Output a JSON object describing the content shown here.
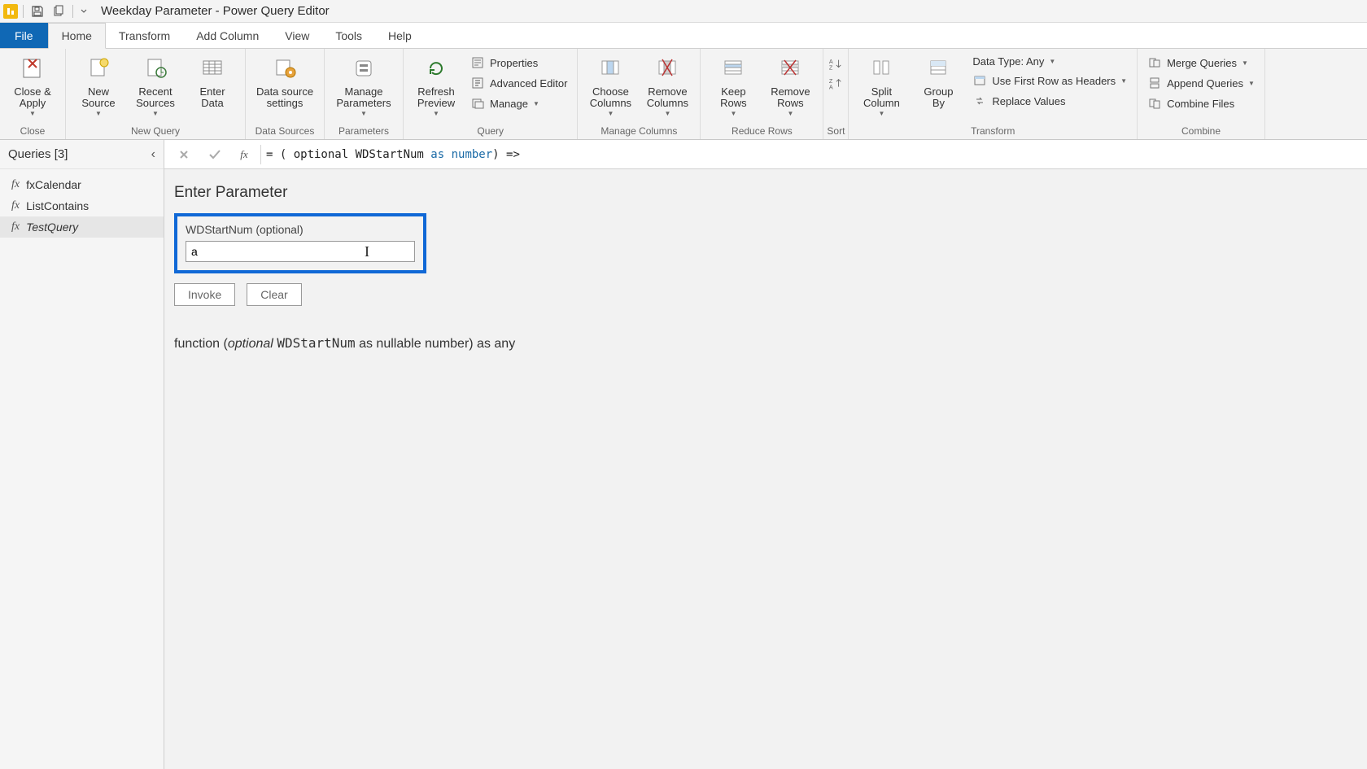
{
  "window_title": "Weekday Parameter - Power Query Editor",
  "tabs": {
    "file": "File",
    "home": "Home",
    "transform": "Transform",
    "add_column": "Add Column",
    "view": "View",
    "tools": "Tools",
    "help": "Help"
  },
  "ribbon": {
    "close_group": {
      "label": "Close",
      "close_apply": "Close &\nApply"
    },
    "new_query_group": {
      "label": "New Query",
      "new_source": "New\nSource",
      "recent_sources": "Recent\nSources",
      "enter_data": "Enter\nData"
    },
    "data_sources_group": {
      "label": "Data Sources",
      "data_source_settings": "Data source\nsettings"
    },
    "parameters_group": {
      "label": "Parameters",
      "manage_parameters": "Manage\nParameters"
    },
    "query_group": {
      "label": "Query",
      "refresh_preview": "Refresh\nPreview",
      "properties": "Properties",
      "advanced_editor": "Advanced Editor",
      "manage": "Manage"
    },
    "manage_columns_group": {
      "label": "Manage Columns",
      "choose_columns": "Choose\nColumns",
      "remove_columns": "Remove\nColumns"
    },
    "reduce_rows_group": {
      "label": "Reduce Rows",
      "keep_rows": "Keep\nRows",
      "remove_rows": "Remove\nRows"
    },
    "sort_group": {
      "label": "Sort"
    },
    "transform_group": {
      "label": "Transform",
      "split_column": "Split\nColumn",
      "group_by": "Group\nBy",
      "data_type": "Data Type: Any",
      "first_row_headers": "Use First Row as Headers",
      "replace_values": "Replace Values"
    },
    "combine_group": {
      "label": "Combine",
      "merge_queries": "Merge Queries",
      "append_queries": "Append Queries",
      "combine_files": "Combine Files"
    }
  },
  "queries_pane": {
    "header": "Queries [3]",
    "items": [
      {
        "name": "fxCalendar",
        "selected": false
      },
      {
        "name": "ListContains",
        "selected": false
      },
      {
        "name": "TestQuery",
        "selected": true
      }
    ]
  },
  "formula_bar": {
    "prefix": "= ( optional WDStartNum ",
    "kw_as": "as",
    "mid": " ",
    "kw_number": "number",
    "suffix": ") =>"
  },
  "parameter_panel": {
    "title": "Enter Parameter",
    "field_label": "WDStartNum (optional)",
    "field_value": "a",
    "invoke": "Invoke",
    "clear": "Clear"
  },
  "signature": {
    "lead": "function (",
    "optional_kw": "optional",
    "space": " ",
    "param_name": "WDStartNum",
    "rest": " as nullable number) as any"
  }
}
